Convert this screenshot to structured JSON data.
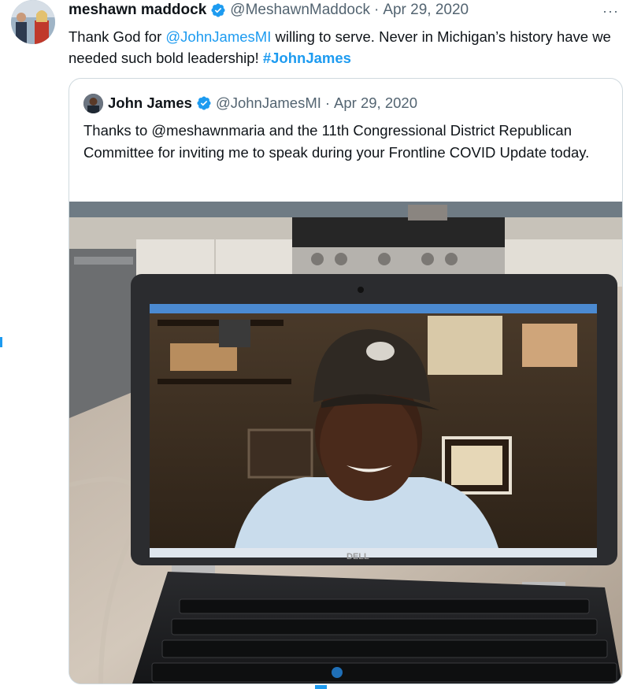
{
  "tweet": {
    "author_name": "meshawn maddock",
    "handle": "@MeshawnMaddock",
    "separator": "·",
    "date": "Apr 29, 2020",
    "more_label": "···",
    "text": {
      "part1": "Thank God for ",
      "mention": "@JohnJamesMI",
      "part2": " willing to serve. Never in Michigan’s history have we needed such bold leadership! ",
      "hashtag": "#JohnJames"
    }
  },
  "quoted_tweet": {
    "author_name": "John James",
    "handle": "@JohnJamesMI",
    "separator": "·",
    "date": "Apr 29, 2020",
    "text": "Thanks to @meshawnmaria and the 11th Congressional District Republican Committee for inviting me to speak during your Frontline COVID Update today.",
    "media": {
      "laptop_brand": "DELL"
    }
  },
  "colors": {
    "link": "#1d9bf0",
    "secondary_text": "#536471",
    "border": "#cfd9de",
    "verified": "#1d9bf0"
  }
}
